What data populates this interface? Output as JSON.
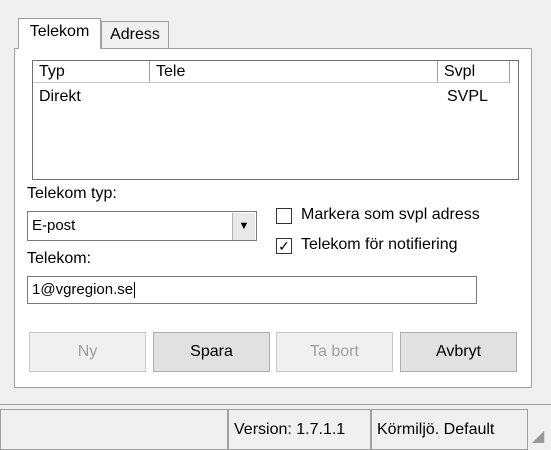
{
  "tabs": [
    {
      "label": "Telekom",
      "active": true
    },
    {
      "label": "Adress",
      "active": false
    }
  ],
  "list": {
    "columns": [
      "Typ",
      "Tele",
      "Svpl"
    ],
    "rows": [
      {
        "typ": "Direkt",
        "tele": "",
        "svpl": "SVPL"
      }
    ]
  },
  "form": {
    "telekom_typ_label": "Telekom typ:",
    "telekom_typ_value": "E-post",
    "telekom_label": "Telekom:",
    "telekom_value": "1@vgregion.se",
    "checkbox_svpl": {
      "label": "Markera som svpl adress",
      "checked": false
    },
    "checkbox_notif": {
      "label": "Telekom för notifiering",
      "checked": true
    },
    "check_mark": "✓",
    "dropdown_arrow": "▼"
  },
  "buttons": {
    "ny": "Ny",
    "spara": "Spara",
    "ta_bort": "Ta bort",
    "avbryt": "Avbryt"
  },
  "statusbar": {
    "version": "Version: 1.7.1.1",
    "env": "Körmiljö. Default"
  }
}
